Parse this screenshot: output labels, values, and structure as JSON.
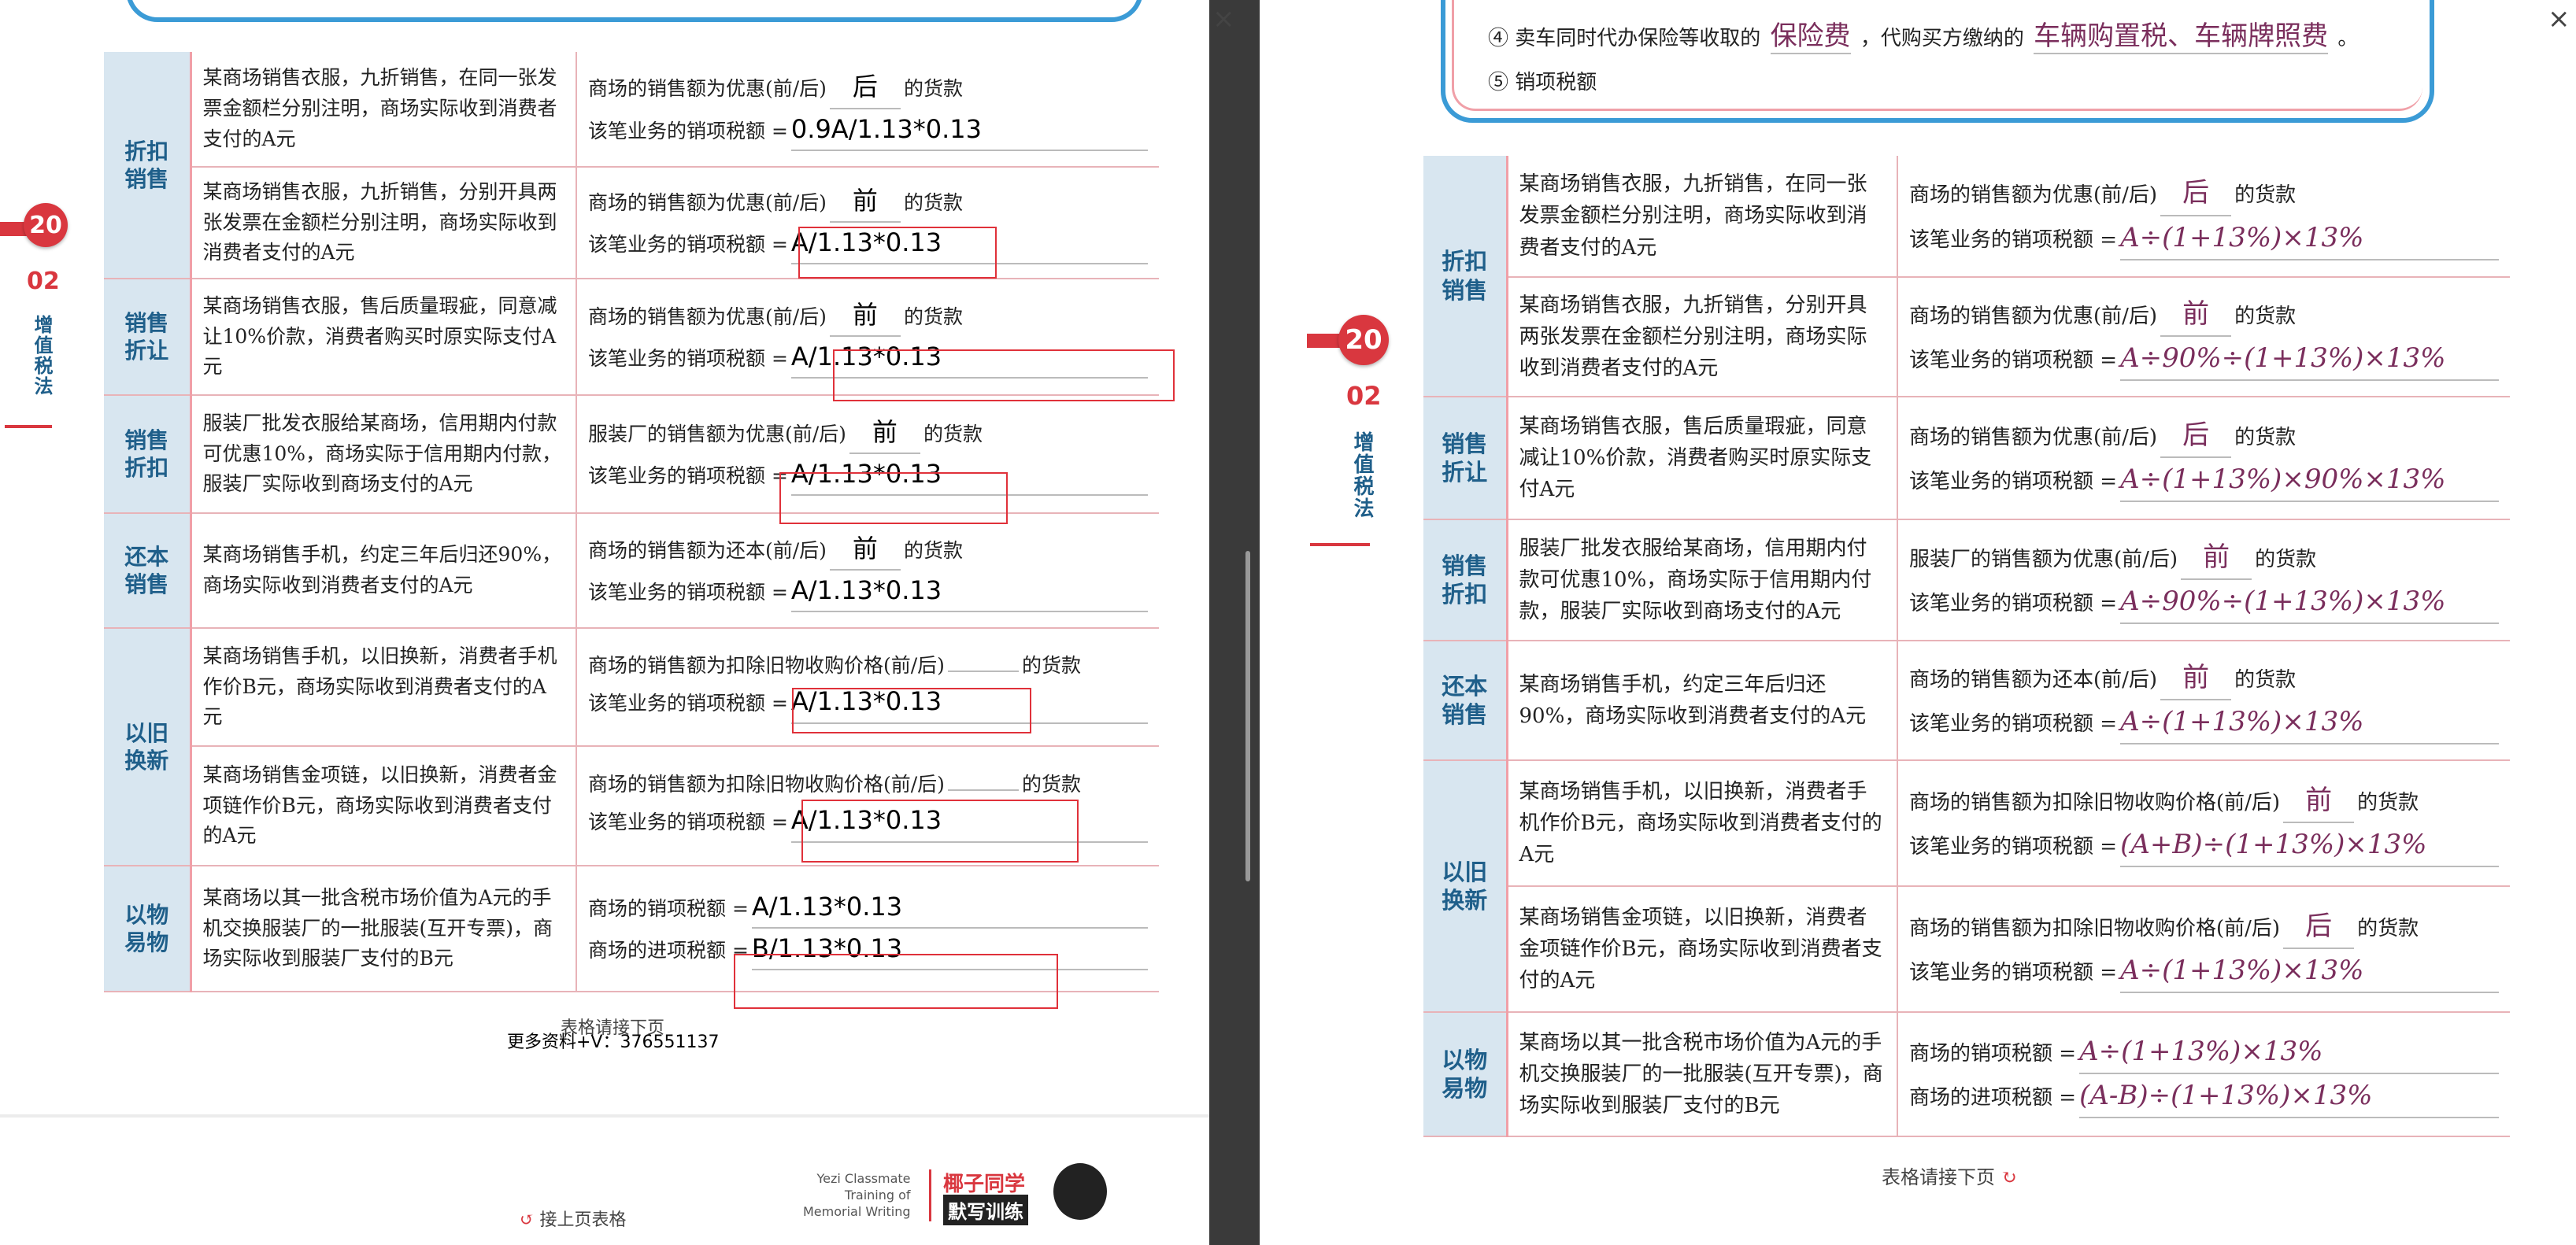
{
  "left": {
    "badge": "20",
    "section_num": "02",
    "section_title": "增值税法",
    "rows": [
      {
        "cat": "折扣销售",
        "desc": "某商场销售衣服，九折销售，在同一张发票金额栏分别注明，商场实际收到消费者支付的A元",
        "l1": "商场的销售额为优惠(前/后)",
        "a1": "后",
        "s1": "的货款",
        "l2": "该笔业务的销项税额 =",
        "a2": "0.9A/1.13*0.13"
      },
      {
        "cat": "",
        "desc": "某商场销售衣服，九折销售，分别开具两张发票在金额栏分别注明，商场实际收到消费者支付的A元",
        "l1": "商场的销售额为优惠(前/后)",
        "a1": "前",
        "s1": "的货款",
        "l2": "该笔业务的销项税额 =",
        "a2": "A/1.13*0.13"
      },
      {
        "cat": "销售折让",
        "desc": "某商场销售衣服，售后质量瑕疵，同意减让10%价款，消费者购买时原实际支付A元",
        "l1": "商场的销售额为优惠(前/后)",
        "a1": "前",
        "s1": "的货款",
        "l2": "该笔业务的销项税额 =",
        "a2": "A/1.13*0.13"
      },
      {
        "cat": "销售折扣",
        "desc": "服装厂批发衣服给某商场，信用期内付款可优惠10%，商场实际于信用期内付款，服装厂实际收到商场支付的A元",
        "l1": "服装厂的销售额为优惠(前/后)",
        "a1": "前",
        "s1": "的货款",
        "l2": "该笔业务的销项税额 =",
        "a2": "A/1.13*0.13"
      },
      {
        "cat": "还本销售",
        "desc": "某商场销售手机，约定三年后归还90%，商场实际收到消费者支付的A元",
        "l1": "商场的销售额为还本(前/后)",
        "a1": "前",
        "s1": "的货款",
        "l2": "该笔业务的销项税额 =",
        "a2": "A/1.13*0.13"
      },
      {
        "cat": "以旧换新",
        "desc": "某商场销售手机，以旧换新，消费者手机作价B元，商场实际收到消费者支付的A元",
        "l1": "商场的销售额为扣除旧物收购价格(前/后)",
        "a1": "",
        "s1": "的货款",
        "l2": "该笔业务的销项税额 =",
        "a2": "A/1.13*0.13"
      },
      {
        "cat": "",
        "desc": "某商场销售金项链，以旧换新，消费者金项链作价B元，商场实际收到消费者支付的A元",
        "l1": "商场的销售额为扣除旧物收购价格(前/后)",
        "a1": "",
        "s1": "的货款",
        "l2": "该笔业务的销项税额 =",
        "a2": "A/1.13*0.13"
      },
      {
        "cat": "以物易物",
        "desc": "某商场以其一批含税市场价值为A元的手机交换服装厂的一批服装(互开专票)，商场实际收到服装厂支付的B元",
        "l1": "商场的销项税额 =",
        "a1": "A/1.13*0.13",
        "s1": "",
        "l2": "商场的进项税额 =",
        "a2": "B/1.13*0.13"
      }
    ],
    "continue_next": "表格请接下页",
    "contact": "更多资料+V：376551137",
    "continue_prev": "接上页表格",
    "brand_en": "Yezi Classmate\nTraining of\nMemorial Writing",
    "brand_cn_top": "椰子同学",
    "brand_cn_bottom": "默写训练"
  },
  "right": {
    "top_line_num": "④",
    "top_line_a": "卖车同时代办保险等收取的",
    "top_line_fill1": "保险费",
    "top_line_b": "，代购买方缴纳的",
    "top_line_fill2": "车辆购置税、车辆牌照费",
    "top_line_end": "。",
    "second_line": "⑤ 销项税额",
    "badge": "20",
    "section_num": "02",
    "section_title": "增值税法",
    "rows": [
      {
        "cat": "折扣销售",
        "desc": "某商场销售衣服，九折销售，在同一张发票金额栏分别注明，商场实际收到消费者支付的A元",
        "l1": "商场的销售额为优惠(前/后)",
        "a1": "后",
        "s1": "的货款",
        "l2": "该笔业务的销项税额 =",
        "a2": "A÷(1+13%)×13%"
      },
      {
        "cat": "",
        "desc": "某商场销售衣服，九折销售，分别开具两张发票在金额栏分别注明，商场实际收到消费者支付的A元",
        "l1": "商场的销售额为优惠(前/后)",
        "a1": "前",
        "s1": "的货款",
        "l2": "该笔业务的销项税额 =",
        "a2": "A÷90%÷(1+13%)×13%"
      },
      {
        "cat": "销售折让",
        "desc": "某商场销售衣服，售后质量瑕疵，同意减让10%价款，消费者购买时原实际支付A元",
        "l1": "商场的销售额为优惠(前/后)",
        "a1": "后",
        "s1": "的货款",
        "l2": "该笔业务的销项税额 =",
        "a2": "A÷(1+13%)×90%×13%"
      },
      {
        "cat": "销售折扣",
        "desc": "服装厂批发衣服给某商场，信用期内付款可优惠10%，商场实际于信用期内付款，服装厂实际收到商场支付的A元",
        "l1": "服装厂的销售额为优惠(前/后)",
        "a1": "前",
        "s1": "的货款",
        "l2": "该笔业务的销项税额 =",
        "a2": "A÷90%÷(1+13%)×13%"
      },
      {
        "cat": "还本销售",
        "desc": "某商场销售手机，约定三年后归还90%，商场实际收到消费者支付的A元",
        "l1": "商场的销售额为还本(前/后)",
        "a1": "前",
        "s1": "的货款",
        "l2": "该笔业务的销项税额 =",
        "a2": "A÷(1+13%)×13%"
      },
      {
        "cat": "以旧换新",
        "desc": "某商场销售手机，以旧换新，消费者手机作价B元，商场实际收到消费者支付的A元",
        "l1": "商场的销售额为扣除旧物收购价格(前/后)",
        "a1": "前",
        "s1": "的货款",
        "l2": "该笔业务的销项税额 =",
        "a2": "(A+B)÷(1+13%)×13%"
      },
      {
        "cat": "",
        "desc": "某商场销售金项链，以旧换新，消费者金项链作价B元，商场实际收到消费者支付的A元",
        "l1": "商场的销售额为扣除旧物收购价格(前/后)",
        "a1": "后",
        "s1": "的货款",
        "l2": "该笔业务的销项税额 =",
        "a2": "A÷(1+13%)×13%"
      },
      {
        "cat": "以物易物",
        "desc": "某商场以其一批含税市场价值为A元的手机交换服装厂的一批服装(互开专票)，商场实际收到服装厂支付的B元",
        "l1": "商场的销项税额 =",
        "a1": "A÷(1+13%)×13%",
        "s1": "",
        "l2": "商场的进项税额 =",
        "a2": "(A-B)÷(1+13%)×13%"
      }
    ],
    "continue_next": "表格请接下页"
  }
}
